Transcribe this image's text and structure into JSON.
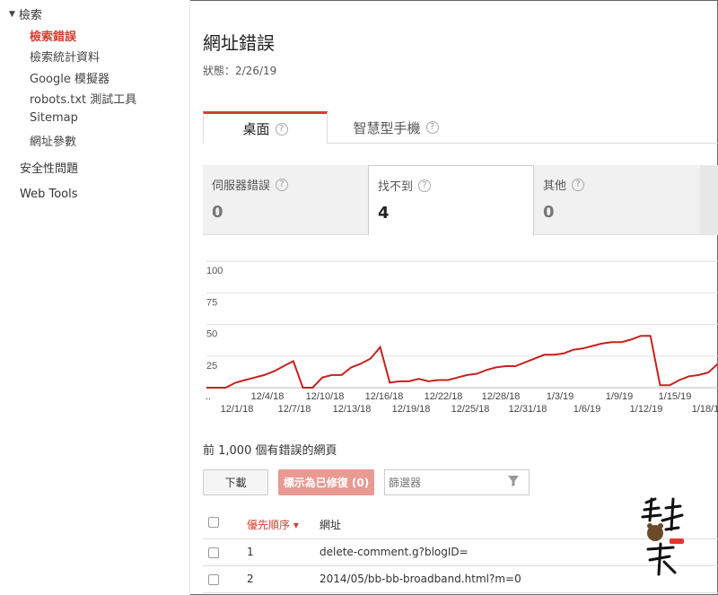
{
  "sidebar": {
    "section_header": "檢索",
    "items": [
      {
        "label": "檢索錯誤",
        "active": true
      },
      {
        "label": "檢索統計資料"
      },
      {
        "label": "Google 模擬器"
      },
      {
        "label": "robots.txt 測試工具"
      },
      {
        "label": "Sitemap"
      },
      {
        "label": "網址參數"
      }
    ],
    "security": "安全性問題",
    "web_tools": "Web Tools"
  },
  "page": {
    "title": "網址錯誤",
    "status": "狀態：2/26/19"
  },
  "tabs": [
    {
      "label": "桌面",
      "selected": true
    },
    {
      "label": "智慧型手機"
    }
  ],
  "error_boxes": [
    {
      "label": "伺服器錯誤",
      "value": "0"
    },
    {
      "label": "找不到",
      "value": "4",
      "selected": true
    },
    {
      "label": "其他",
      "value": "0"
    }
  ],
  "chart_data": {
    "type": "line",
    "ylim": [
      0,
      100
    ],
    "y_ticks": [
      "100",
      "75",
      "50",
      "25"
    ],
    "x_labels_upper": [
      "..",
      "12/4/18",
      "12/10/18",
      "12/16/18",
      "12/22/18",
      "12/28/18",
      "1/3/19",
      "1/9/19",
      "1/15/19"
    ],
    "x_labels_lower": [
      "12/1/18",
      "12/7/18",
      "12/13/18",
      "12/19/18",
      "12/25/18",
      "12/31/18",
      "1/6/19",
      "1/12/19",
      "1/18/1"
    ],
    "series": [
      {
        "color": "#c5221f",
        "values": [
          0,
          0,
          0,
          4,
          6,
          8,
          10,
          13,
          17,
          21,
          0,
          0,
          8,
          10,
          10,
          16,
          19,
          23,
          32,
          4,
          5,
          5,
          7,
          5,
          6,
          6,
          8,
          10,
          11,
          14,
          16,
          17,
          17,
          20,
          23,
          26,
          26,
          27,
          30,
          31,
          33,
          35,
          36,
          36,
          38,
          41,
          41,
          2,
          2,
          6,
          9,
          10,
          12,
          19
        ]
      }
    ]
  },
  "pages_label": "前 1,000 個有錯誤的網頁",
  "toolbar": {
    "download": "下載",
    "mark_fixed": "標示為已修復 (0)",
    "filter_placeholder": "篩選器"
  },
  "table": {
    "headers": {
      "priority": "優先順序 ▾",
      "url": "網址"
    },
    "rows": [
      {
        "priority": "1",
        "url": "delete-comment.g?blogID="
      },
      {
        "priority": "2",
        "url": "2014/05/bb-bb-broadband.html?m=0"
      }
    ]
  },
  "colors": {
    "accent": "#d23f31",
    "line": "#c5221f"
  }
}
